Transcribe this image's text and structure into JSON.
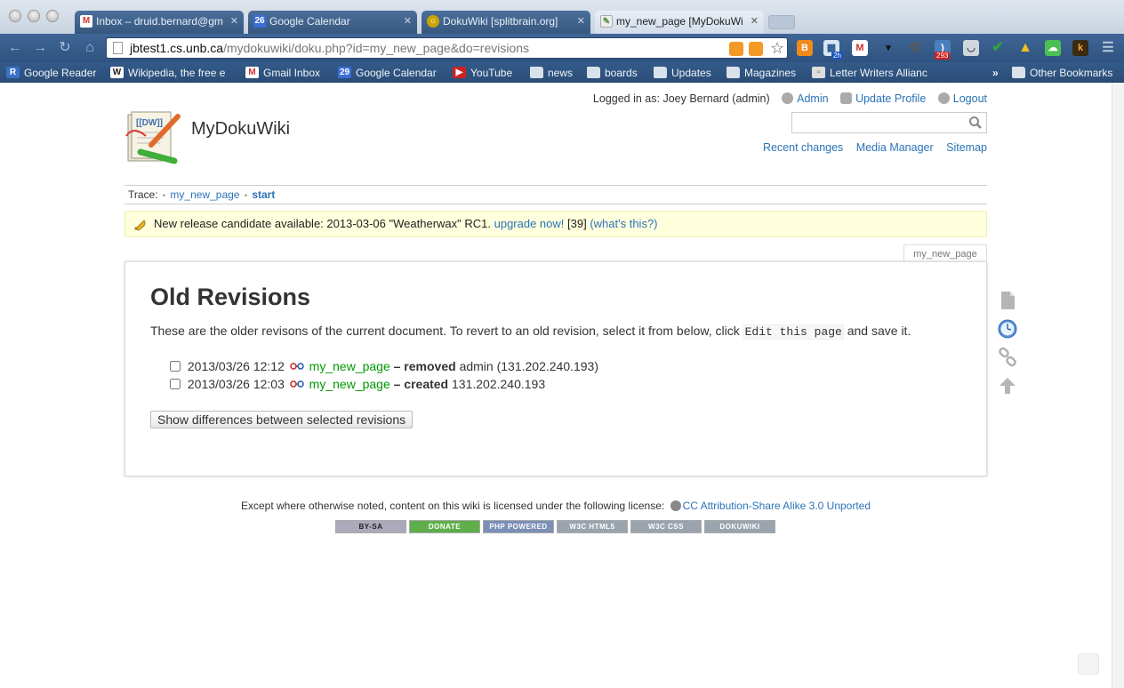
{
  "browser": {
    "tabs": [
      {
        "title": "Inbox – druid.bernard@gm",
        "icon": "gmail-icon",
        "color": "#c33"
      },
      {
        "title": "Google Calendar",
        "icon": "calendar-icon",
        "color": "#3a6ed8"
      },
      {
        "title": "DokuWiki [splitbrain.org]",
        "icon": "dokuwiki-icon",
        "color": "#c9a300"
      },
      {
        "title": "my_new_page [MyDokuWi",
        "icon": "dokuwiki-icon",
        "color": "#5a8f3b"
      }
    ],
    "url_host": "jbtest1.cs.unb.ca",
    "url_path": "/mydokuwiki/doku.php?id=my_new_page&do=revisions",
    "extension_badges": {
      "calendar": "2h",
      "feeds": "293"
    },
    "bookmarks": [
      {
        "label": "Google Reader",
        "icon": "google-reader-icon"
      },
      {
        "label": "Wikipedia, the free e",
        "icon": "wikipedia-icon"
      },
      {
        "label": "Gmail Inbox",
        "icon": "gmail-icon"
      },
      {
        "label": "Google Calendar",
        "icon": "calendar-icon"
      },
      {
        "label": "YouTube",
        "icon": "youtube-icon"
      },
      {
        "label": "news",
        "icon": "folder-icon"
      },
      {
        "label": "boards",
        "icon": "folder-icon"
      },
      {
        "label": "Updates",
        "icon": "folder-icon"
      },
      {
        "label": "Magazines",
        "icon": "folder-icon"
      },
      {
        "label": "Letter Writers Allianc",
        "icon": "page-icon"
      }
    ],
    "bookmarks_overflow": "»",
    "other_bookmarks": "Other Bookmarks"
  },
  "wiki": {
    "site_title": "MyDokuWiki",
    "user": {
      "logged_in_label": "Logged in as: Joey Bernard (admin)",
      "admin": "Admin",
      "update_profile": "Update Profile",
      "logout": "Logout"
    },
    "site_tools": {
      "recent_changes": "Recent changes",
      "media_manager": "Media Manager",
      "sitemap": "Sitemap"
    },
    "breadcrumb": {
      "label": "Trace:",
      "items": [
        "my_new_page",
        "start"
      ]
    },
    "notice": {
      "text": "New release candidate available: 2013-03-06 \"Weatherwax\" RC1.",
      "upgrade_link": "upgrade now!",
      "count": "[39]",
      "whats_this": "(what's this?)"
    },
    "page_id": "my_new_page",
    "content": {
      "heading": "Old Revisions",
      "intro_before": "These are the older revisons of the current document. To revert to an old revision, select it from below, click ",
      "intro_code": "Edit this page",
      "intro_after": " and save it.",
      "revisions": [
        {
          "date": "2013/03/26 12:12",
          "page": "my_new_page",
          "summary": "– removed",
          "user": "admin (131.202.240.193)"
        },
        {
          "date": "2013/03/26 12:03",
          "page": "my_new_page",
          "summary": "– created",
          "user": "131.202.240.193"
        }
      ],
      "diff_button": "Show differences between selected revisions"
    },
    "footer": {
      "license_text": "Except where otherwise noted, content on this wiki is licensed under the following license:",
      "license_link": "CC Attribution-Share Alike 3.0 Unported",
      "badges": [
        "BY-SA",
        "DONATE",
        "PHP POWERED",
        "W3C HTML5",
        "W3C CSS",
        "DOKUWIKI"
      ]
    }
  }
}
